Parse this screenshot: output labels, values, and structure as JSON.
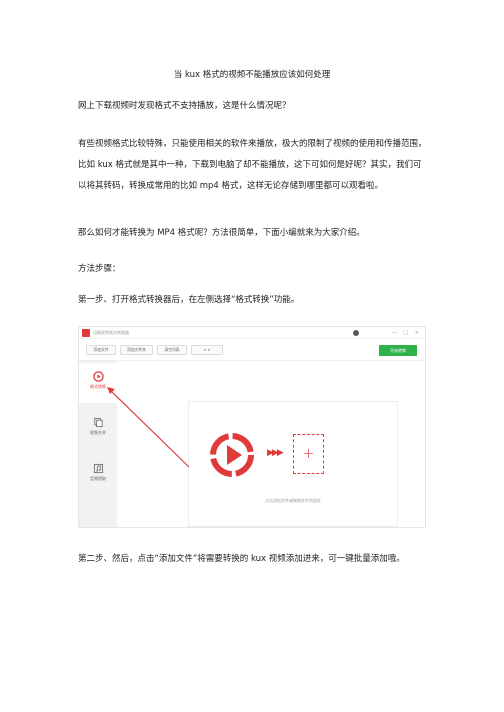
{
  "doc": {
    "title": "当 kux 格式的视频不能播放应该如何处理",
    "paragraphs": [
      "网上下载视频时发现格式不支持播放，这是什么情况呢？",
      "有些视频格式比较特殊，只能使用相关的软件来播放，极大的限制了视频的使用和传播范围，比如 kux 格式就是其中一种，下载到电脑了却不能播放，这下可如何是好呢？其实，我们可以将其转码，转换成常用的比如 mp4 格式，这样无论存储到哪里都可以观看啦。",
      "那么如何才能转换为 MP4 格式呢？方法很简单，下面小编就来为大家介绍。",
      "方法步骤：",
      "第一步、打开格式转换器后，在左侧选择“格式转换”功能。",
      "第二步、然后，点击“添加文件”将需要转换的 kux 视频添加进来，可一键批量添加哦。"
    ]
  },
  "screenshot": {
    "app_name": "迅捷视频格式转换器",
    "username": "●",
    "window_controls": [
      "—",
      "□",
      "×"
    ],
    "toolbar": {
      "add_file": "添加文件",
      "add_folder": "添加文件夹",
      "clear_list": "清空列表",
      "sort": "∧ ∨",
      "start": "开始转换"
    },
    "sidebar": [
      {
        "label": "格式转换",
        "icon": "play-circle-icon",
        "active": true
      },
      {
        "label": "视频合并",
        "icon": "merge-icon",
        "active": false
      },
      {
        "label": "音频提取",
        "icon": "music-note-icon",
        "active": false
      }
    ],
    "dropzone": {
      "arrows": "▶▶▶",
      "plus": "+",
      "hint": "点击添加文件或拖拽文件到此处"
    },
    "accent_color": "#e03a3a",
    "start_color": "#2db34a"
  }
}
